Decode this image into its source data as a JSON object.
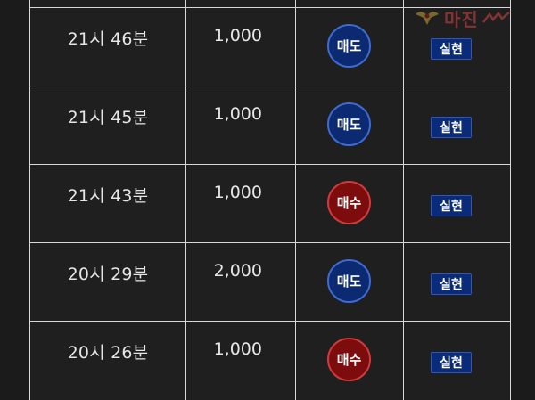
{
  "trades": [
    {
      "time": "21시 46분",
      "quantity": "1,000",
      "side": "매도",
      "side_type": "sell",
      "status": "실현"
    },
    {
      "time": "21시 45분",
      "quantity": "1,000",
      "side": "매도",
      "side_type": "sell",
      "status": "실현"
    },
    {
      "time": "21시 43분",
      "quantity": "1,000",
      "side": "매수",
      "side_type": "buy",
      "status": "실현"
    },
    {
      "time": "20시 29분",
      "quantity": "2,000",
      "side": "매도",
      "side_type": "sell",
      "status": "실현"
    },
    {
      "time": "20시 26분",
      "quantity": "1,000",
      "side": "매수",
      "side_type": "buy",
      "status": "실현"
    }
  ],
  "colors": {
    "background": "#1b1b1b",
    "grid_line": "#d8d8d8",
    "sell": "#0b2a72",
    "buy": "#7d0d0d",
    "status_badge": "#0a2b7a",
    "watermark": "#d44444"
  },
  "watermark": {
    "text": "마진",
    "emblem_icon": "eagle-emblem-icon"
  }
}
